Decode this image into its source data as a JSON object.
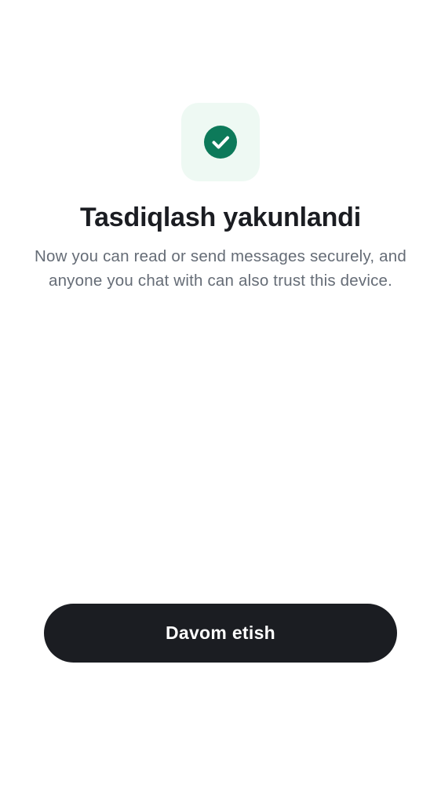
{
  "verification": {
    "icon": "check-circle-icon",
    "title": "Tasdiqlash yakunlandi",
    "description": "Now you can read or send messages securely, and anyone you chat with can also trust this device."
  },
  "actions": {
    "continue_label": "Davom etish"
  },
  "colors": {
    "background": "#ffffff",
    "icon_tile": "#eef9f3",
    "success_green": "#0d7a5a",
    "title_text": "#1b1d22",
    "body_text": "#656c76",
    "button_bg": "#1b1d22",
    "button_text": "#ffffff"
  }
}
